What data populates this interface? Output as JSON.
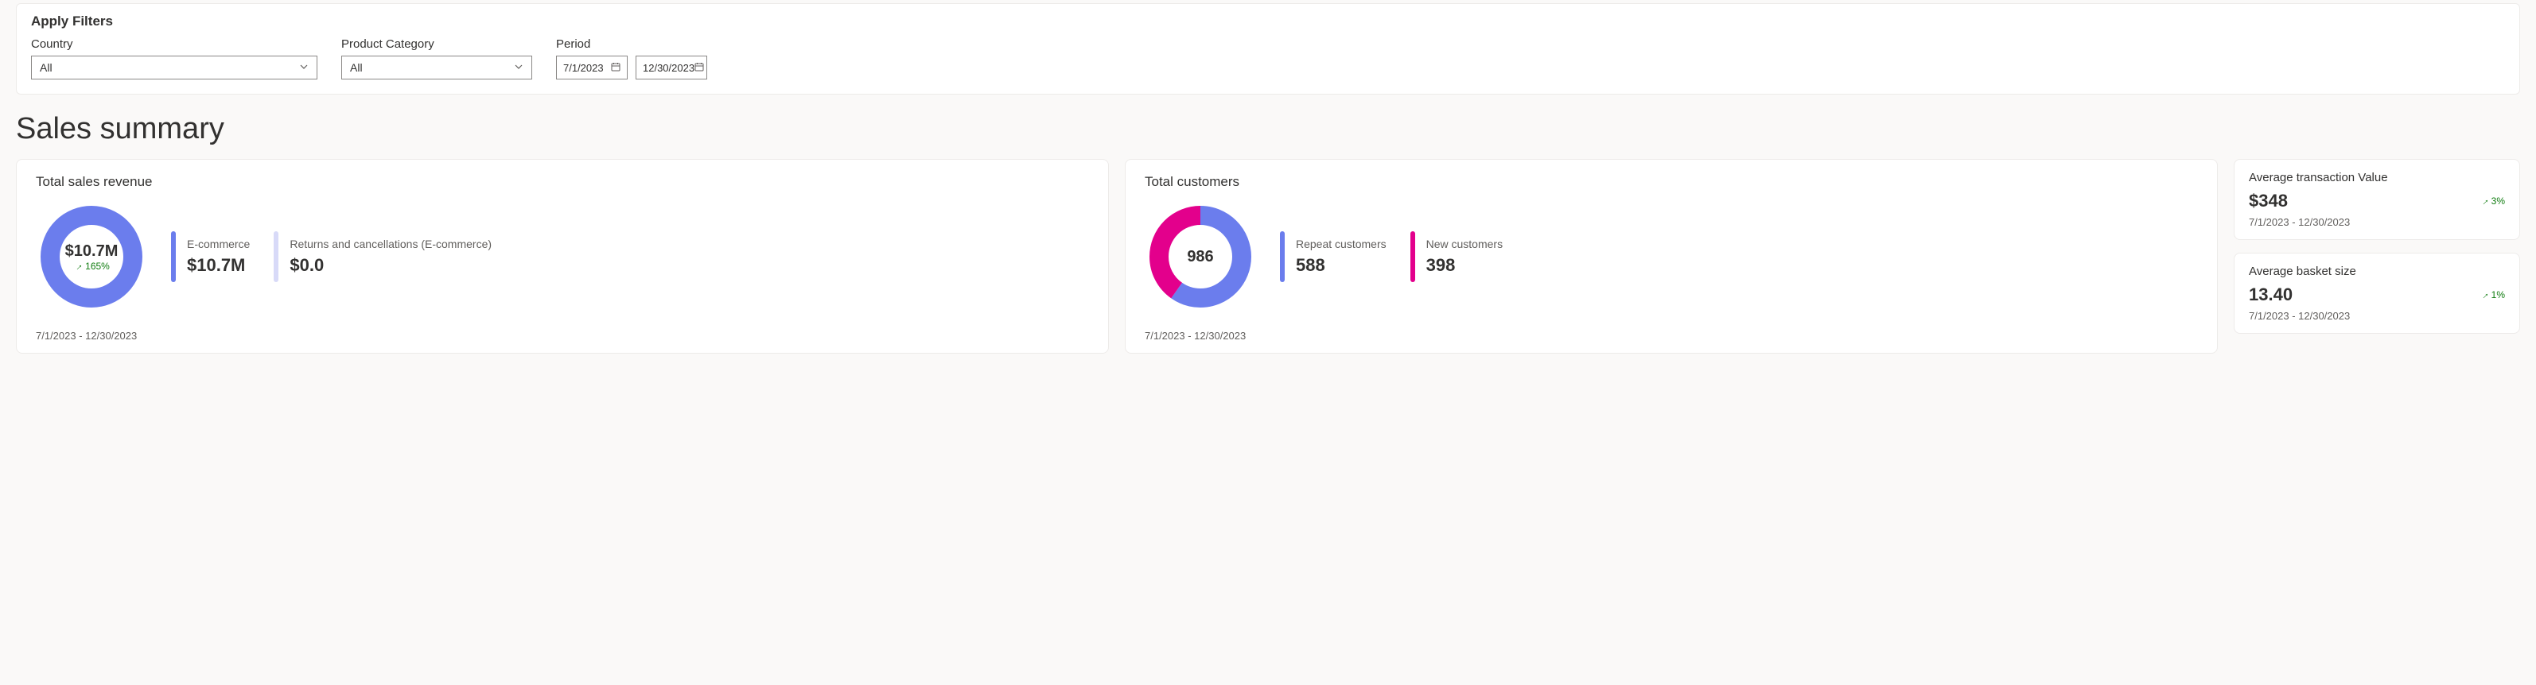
{
  "filters": {
    "title": "Apply Filters",
    "country": {
      "label": "Country",
      "value": "All"
    },
    "category": {
      "label": "Product Category",
      "value": "All"
    },
    "period": {
      "label": "Period",
      "start": "7/1/2023",
      "end": "12/30/2023"
    }
  },
  "page_title": "Sales summary",
  "revenue": {
    "title": "Total sales revenue",
    "total": "$10.7M",
    "trend": "165%",
    "ecommerce": {
      "label": "E-commerce",
      "value": "$10.7M"
    },
    "returns": {
      "label": "Returns and cancellations (E-commerce)",
      "value": "$0.0"
    },
    "date_range": "7/1/2023 - 12/30/2023"
  },
  "customers": {
    "title": "Total customers",
    "total": "986",
    "repeat": {
      "label": "Repeat customers",
      "value": "588"
    },
    "new": {
      "label": "New customers",
      "value": "398"
    },
    "date_range": "7/1/2023 - 12/30/2023"
  },
  "avg_transaction": {
    "title": "Average transaction Value",
    "value": "$348",
    "trend": "3%",
    "date_range": "7/1/2023 - 12/30/2023"
  },
  "avg_basket": {
    "title": "Average basket size",
    "value": "13.40",
    "trend": "1%",
    "date_range": "7/1/2023 - 12/30/2023"
  },
  "colors": {
    "indigo": "#6b7ded",
    "indigo_light": "#d8daf8",
    "magenta": "#e3008c"
  },
  "chart_data": [
    {
      "type": "pie",
      "title": "Total sales revenue",
      "series": [
        {
          "name": "E-commerce",
          "value": 10.7,
          "unit": "$M",
          "color": "#6b7ded"
        },
        {
          "name": "Returns and cancellations (E-commerce)",
          "value": 0.0,
          "unit": "$M",
          "color": "#d8daf8"
        }
      ],
      "center_label": "$10.7M"
    },
    {
      "type": "pie",
      "title": "Total customers",
      "series": [
        {
          "name": "Repeat customers",
          "value": 588,
          "color": "#6b7ded"
        },
        {
          "name": "New customers",
          "value": 398,
          "color": "#e3008c"
        }
      ],
      "center_label": "986"
    }
  ]
}
